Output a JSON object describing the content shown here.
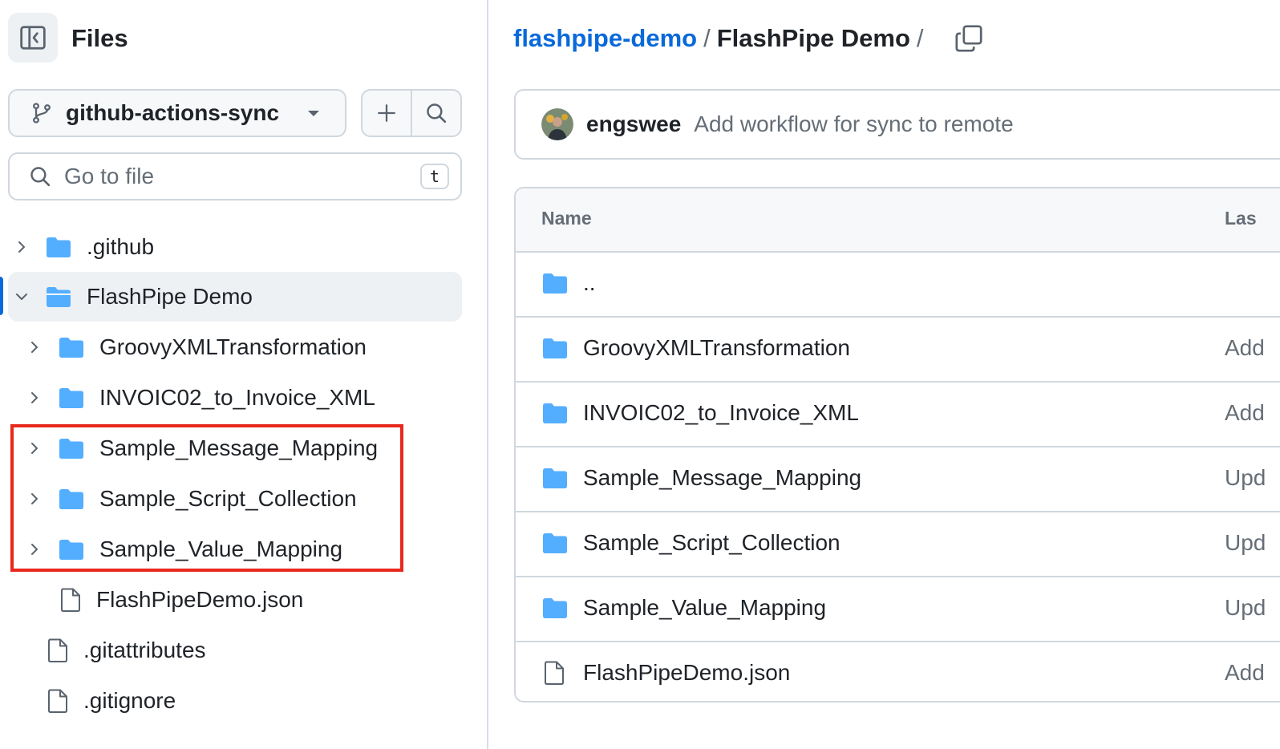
{
  "sidebar": {
    "title": "Files",
    "branch": "github-actions-sync",
    "search": {
      "placeholder": "Go to file",
      "shortcut": "t"
    },
    "tree": [
      {
        "label": ".github"
      },
      {
        "label": "FlashPipe Demo"
      },
      {
        "label": "GroovyXMLTransformation"
      },
      {
        "label": "INVOIC02_to_Invoice_XML"
      },
      {
        "label": "Sample_Message_Mapping"
      },
      {
        "label": "Sample_Script_Collection"
      },
      {
        "label": "Sample_Value_Mapping"
      },
      {
        "label": "FlashPipeDemo.json"
      },
      {
        "label": ".gitattributes"
      },
      {
        "label": ".gitignore"
      }
    ]
  },
  "breadcrumb": {
    "repo": "flashpipe-demo",
    "sep1": "/",
    "folder": "FlashPipe Demo",
    "sep2": "/"
  },
  "commit": {
    "author": "engswee",
    "message": "Add workflow for sync to remote"
  },
  "table": {
    "col_name": "Name",
    "col_last": "Las",
    "rows": [
      {
        "name": "..",
        "msg": ""
      },
      {
        "name": "GroovyXMLTransformation",
        "msg": "Add"
      },
      {
        "name": "INVOIC02_to_Invoice_XML",
        "msg": "Add"
      },
      {
        "name": "Sample_Message_Mapping",
        "msg": "Upd"
      },
      {
        "name": "Sample_Script_Collection",
        "msg": "Upd"
      },
      {
        "name": "Sample_Value_Mapping",
        "msg": "Upd"
      },
      {
        "name": "FlashPipeDemo.json",
        "msg": "Add"
      }
    ]
  },
  "colors": {
    "accent": "#0969da",
    "folder": "#54aeff",
    "highlight": "#e8281c"
  }
}
